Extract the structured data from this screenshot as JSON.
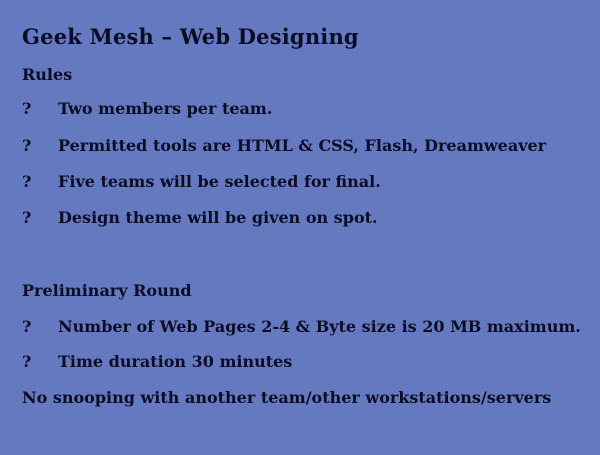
{
  "title": "Geek Mesh – Web Designing",
  "rules": {
    "heading": "Rules",
    "items": [
      {
        "bullet": "?",
        "text": "Two members per team."
      },
      {
        "bullet": "?",
        "text": "Permitted tools are HTML & CSS, Flash, Dreamweaver"
      },
      {
        "bullet": "?",
        "text": "Five teams will be selected for final."
      },
      {
        "bullet": "?",
        "text": "Design theme will be given on spot."
      }
    ]
  },
  "preliminary": {
    "heading": "Preliminary Round",
    "items": [
      {
        "bullet": "?",
        "text": "Number of Web Pages 2-4 & Byte size is 20 MB maximum."
      },
      {
        "bullet": "?",
        "text": "Time duration 30 minutes"
      }
    ],
    "note": "No snooping with another team/other workstations/servers"
  },
  "colors": {
    "background": "#6479c0",
    "text": "#0c0c24"
  }
}
